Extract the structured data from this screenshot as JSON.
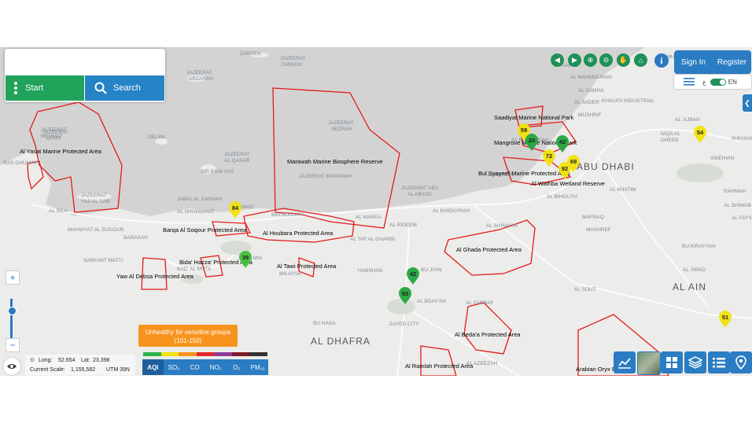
{
  "start_panel": {
    "start_label": "Start",
    "search_label": "Search"
  },
  "header": {
    "sign_in": "Sign In",
    "register": "Register",
    "info": "i",
    "lang_ar": "ع",
    "lang_en": "EN"
  },
  "map": {
    "regions": [
      "AL DHAFRA",
      "ABU DHABI",
      "AL AIN"
    ],
    "protected_areas": [
      "Al Yasat Marine Protected Area",
      "Marawah Marine Biosphere Reserve",
      "Barqa Al Soqour Protected Area",
      "Al Houbara Protected Area",
      "Bida' Hazza' Protected Area",
      "Yaw Al Debsa Protected Area",
      "Al Tawi Protected Area",
      "Al Ghada Protected Area",
      "Al Beda'a Protected Area",
      "Al Ramlah Protected Area",
      "Saadiyat Marine National Park",
      "Mangrove Marine National Park",
      "Bul Syayeef Marine Protected Area",
      "Al Wathba Wetland Reserve",
      "Arabian Oryx Reserve"
    ],
    "places": [
      "ZARKEN",
      "JAZEERAT ARZANAH",
      "JAZEERAT AFFAY",
      "JAZEERAT MEHMAT",
      "RAS GHUMAYS",
      "AL SILA",
      "DELMA",
      "SIR BANI YAS",
      "JAZEERAT AL QASAR",
      "JAZEERAT YAS AL SAB",
      "JAZEERAT NEZRAH",
      "JAZEERAT MARAWAH",
      "JAZEERAT ABU AL ABYAD",
      "JABAL AL ZANNAH",
      "AL SHUWAIHAT",
      "RUWAIS",
      "MAHWYAT AL SUGOUR",
      "BARAKAH",
      "SABKHAT MATTI",
      "BAYNOUNAH",
      "AL TAF AL GHARBI",
      "AL RIDEEM",
      "AL MAREA",
      "HABSHAN",
      "LIWA",
      "BU HASA",
      "ZAYED CITY",
      "AL BDAY'AH",
      "AL SHINAYIN",
      "AL SOUT",
      "AL ZARRAF",
      "AL AZEEZAH",
      "AL DHAFRA",
      "KHALIFA INDUSTRIAL",
      "AL MAHMOURAH",
      "AL SAMHA",
      "ABU DHABI",
      "AL KHATIM",
      "MAFRAQ",
      "AL BIHOUTH",
      "AL KHIDAYRAH",
      "MUSHRIF",
      "AL RAHBA",
      "NIQA AL DHEEB",
      "AL 'AJBAN",
      "SWEIHAN",
      "MASHREF",
      "BU KIRAYYAH",
      "AL 'ARAD",
      "AL AIN",
      "SHIYAYAH",
      "AL SHIWAB",
      "AL FAYYAH",
      "RAHMAH",
      "AL SADER",
      "AL MUGHAIRAH",
      "HILAL"
    ],
    "markers": [
      {
        "value": 84,
        "color": "#f2e20d"
      },
      {
        "value": 39,
        "color": "#3fbf3a"
      },
      {
        "value": 42,
        "color": "#21a53c"
      },
      {
        "value": 50,
        "color": "#21a53c"
      },
      {
        "value": 59,
        "color": "#f2e20d"
      },
      {
        "value": 24,
        "color": "#21a53c"
      },
      {
        "value": 42,
        "color": "#21a53c"
      },
      {
        "value": 72,
        "color": "#f2e20d"
      },
      {
        "value": 69,
        "color": "#f2e20d"
      },
      {
        "value": 92,
        "color": "#f2e20d"
      },
      {
        "value": 54,
        "color": "#f2e20d"
      },
      {
        "value": 51,
        "color": "#f2e20d"
      }
    ]
  },
  "toolbar": {
    "icons": [
      "back-icon",
      "forward-icon",
      "zoom-in-icon",
      "zoom-out-icon",
      "pan-hand-icon",
      "home-icon"
    ]
  },
  "controls": {
    "zoom_in": "+",
    "zoom_out": "−"
  },
  "coords": {
    "long_label": "Long:",
    "long": "52.654",
    "lat_label": "Lat:",
    "lat": "23.398",
    "scale_label": "Current Scale:",
    "scale": "1,155,582",
    "utm": "UTM 39N"
  },
  "aqi": {
    "tooltip": "Unhealthy for sensitive groupa (101-150)",
    "scale_colors": [
      "#2db34a",
      "#f2e20d",
      "#f7941d",
      "#e5272d",
      "#8e3b97",
      "#7b1a2a",
      "#333333"
    ],
    "tabs": [
      "AQI",
      "SO₂",
      "CO",
      "NO₂",
      "O₃",
      "PM₁₀"
    ],
    "active_tab": "AQI"
  },
  "colors": {
    "protected_area_outline": "#e31b1b",
    "accent_blue": "#2a7cc3",
    "accent_green": "#21a35a"
  }
}
